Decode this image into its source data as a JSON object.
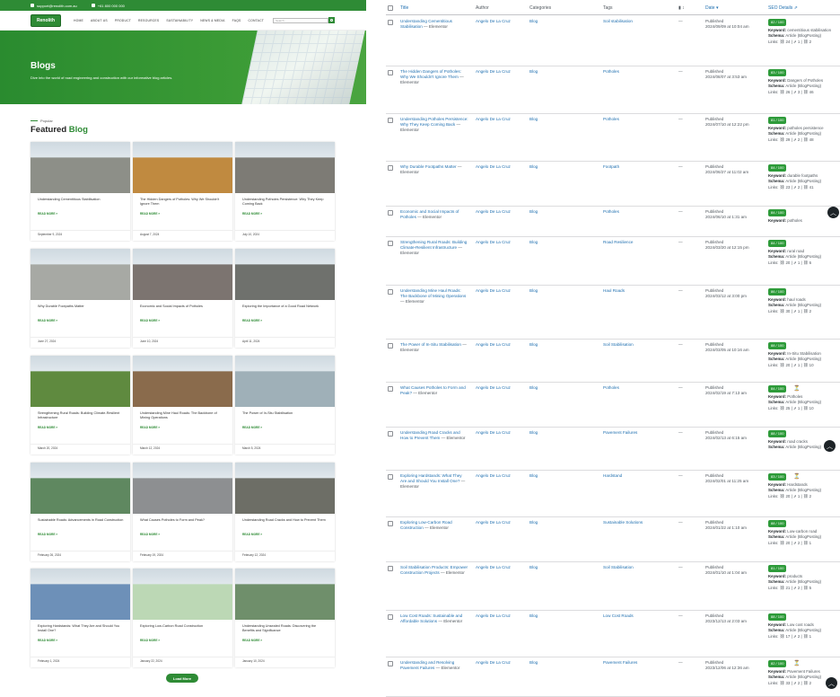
{
  "site": {
    "topbar": {
      "email": "support@renolith.com.au",
      "phone": "+61 800 000 000"
    },
    "logo": "Renolith",
    "menu": [
      "HOME",
      "ABOUT US",
      "PRODUCT",
      "RESOURCES",
      "SUSTAINABILITY",
      "NEWS & MEDIA",
      "FAQS",
      "CONTACT"
    ],
    "search_placeholder": "Search...",
    "hero": {
      "title": "Blogs",
      "subtitle": "Dive into the world of road engineering and construction with our informative blog articles."
    },
    "popular_label": "Popular",
    "featured": {
      "prefix": "Featured ",
      "accent": "Blog"
    },
    "read_more": "READ MORE »",
    "load_more": "Load More",
    "cards": [
      {
        "title": "Understanding Cementitious Stabilisation",
        "date": "September 9, 2024"
      },
      {
        "title": "The Hidden Dangers of Potholes: Why We Shouldn't Ignore Them",
        "date": "August 7, 2024"
      },
      {
        "title": "Understanding Potholes Persistence: Why They Keep Coming Back",
        "date": "July 10, 2024"
      },
      {
        "title": "Why Durable Footpaths Matter",
        "date": "June 27, 2024"
      },
      {
        "title": "Economic and Social Impacts of Potholes",
        "date": "June 10, 2024"
      },
      {
        "title": "Exploring the Importance of a Good Road Network",
        "date": "April 11, 2024"
      },
      {
        "title": "Strengthening Rural Roads: Building Climate-Resilient Infrastructure",
        "date": "March 20, 2024"
      },
      {
        "title": "Understanding Mine Haul Roads: The Backbone of Mining Operations",
        "date": "March 12, 2024"
      },
      {
        "title": "The Power of In-Situ Stabilisation",
        "date": "March 5, 2024"
      },
      {
        "title": "Sustainable Roads: Advancements in Road Construction",
        "date": "February 26, 2024"
      },
      {
        "title": "What Causes Potholes to Form and Peak?",
        "date": "February 19, 2024"
      },
      {
        "title": "Understanding Road Cracks and How to Prevent Them",
        "date": "February 12, 2024"
      },
      {
        "title": "Exploring Hardstands: What They Are and Should You Install One?",
        "date": "February 1, 2024"
      },
      {
        "title": "Exploring Low-Carbon Road Construction",
        "date": "January 22, 2024"
      },
      {
        "title": "Understanding Unsealed Roads: Discovering the Benefits and Significance",
        "date": "January 10, 2024"
      }
    ],
    "card_colors": [
      "#8d8f88",
      "#c08a40",
      "#7d7b75",
      "#a7a9a4",
      "#7c7470",
      "#6f716d",
      "#5f8a3f",
      "#8a6b4c",
      "#9fb0b8",
      "#5f8860",
      "#8d8f91",
      "#6d6e66",
      "#6d90b8",
      "#bcd8b5",
      "#6f8f6b"
    ]
  },
  "admin": {
    "headers": {
      "title": "Title",
      "author": "Author",
      "categories": "Categories",
      "tags": "Tags",
      "comments": "▮ ↕",
      "date": "Date ▾",
      "seo": "SEO Details ⇗"
    },
    "rows": [
      {
        "title": "Understanding Cementitious Stabilisation",
        "suffix": " — Elementor",
        "author": "Angelo De La Cruz",
        "category": "Blog",
        "tag": "Soil stabilisation",
        "comments": "—",
        "status": "Published",
        "date": "2024/09/09 at 10:04 am",
        "score": "82 / 100",
        "keyword": "cementitious stabilisation",
        "schema": "Article (BlogPosting)",
        "links": "Links: ⛓ 24 | ⇗ 1 | ⛓ 2"
      },
      {
        "title": "The Hidden Dangers of Potholes: Why We Shouldn't Ignore Them",
        "suffix": " — Elementor",
        "author": "Angelo De La Cruz",
        "category": "Blog",
        "tag": "Potholes",
        "comments": "—",
        "status": "Published",
        "date": "2024/08/07 at 3:53 am",
        "score": "83 / 100",
        "keyword": "Dangers of Potholes",
        "schema": "Article (BlogPosting)",
        "links": "Links: ⛓ 26 | ⇗ 3 | ⛓ 46"
      },
      {
        "title": "Understanding Potholes Persistence: Why They Keep Coming Back",
        "suffix": " — Elementor",
        "author": "Angelo De La Cruz",
        "category": "Blog",
        "tag": "Potholes",
        "comments": "—",
        "status": "Published",
        "date": "2024/07/10 at 12:22 pm",
        "score": "81 / 100",
        "keyword": "potholes persistence",
        "schema": "Article (BlogPosting)",
        "links": "Links: ⛓ 29 | ⇗ 2 | ⛓ 48"
      },
      {
        "title": "Why Durable Footpaths Matter",
        "suffix": " — Elementor",
        "author": "Angelo De La Cruz",
        "category": "Blog",
        "tag": "Footpath",
        "comments": "—",
        "status": "Published",
        "date": "2024/06/27 at 11:02 am",
        "score": "84 / 100",
        "keyword": "durable footpaths",
        "schema": "Article (BlogPosting)",
        "links": "Links: ⛓ 23 | ⇗ 2 | ⛓ 41"
      },
      {
        "title": "Economic and Social Impacts of Potholes",
        "suffix": " — Elementor",
        "author": "Angelo De La Cruz",
        "category": "Blog",
        "tag": "Potholes",
        "comments": "—",
        "status": "Published",
        "date": "2024/06/10 at 1:31 am",
        "score": "84 / 100",
        "keyword": "potholes",
        "schema": "",
        "links": ""
      },
      {
        "title": "Strengthening Rural Roads: Building Climate-Resilient Infrastructure",
        "suffix": " — Elementor",
        "author": "Angelo De La Cruz",
        "category": "Blog",
        "tag": "Road Resilience",
        "comments": "—",
        "status": "Published",
        "date": "2024/03/20 at 12:15 pm",
        "score": "84 / 100",
        "keyword": "rural road",
        "schema": "Article (BlogPosting)",
        "links": "Links: ⛓ 20 | ⇗ 1 | ⛓ 6"
      },
      {
        "title": "Understanding Mine Haul Roads: The Backbone of Mining Operations",
        "suffix": " — Elementor",
        "author": "Angelo De La Cruz",
        "category": "Blog",
        "tag": "Haul Roads",
        "comments": "—",
        "status": "Published",
        "date": "2024/03/12 at 3:00 pm",
        "score": "86 / 100",
        "keyword": "haul roads",
        "schema": "Article (BlogPosting)",
        "links": "Links: ⛓ 30 | ⇗ 1 | ⛓ 2"
      },
      {
        "title": "The Power of In-Situ Stabilisation",
        "suffix": " — Elementor",
        "author": "Angelo De La Cruz",
        "category": "Blog",
        "tag": "Soil Stabilisation",
        "comments": "—",
        "status": "Published",
        "date": "2024/03/05 at 10:16 am",
        "score": "88 / 100",
        "keyword": "In-Situ Stabilisation",
        "schema": "Article (BlogPosting)",
        "links": "Links: ⛓ 20 | ⇗ 1 | ⛓ 10"
      },
      {
        "title": "What Causes Potholes to Form and Peak?",
        "suffix": " — Elementor",
        "author": "Angelo De La Cruz",
        "category": "Blog",
        "tag": "Potholes",
        "comments": "—",
        "status": "Published",
        "date": "2024/02/19 at 7:13 am",
        "score": "84 / 100",
        "keyword": "Potholes",
        "schema": "Article (BlogPosting)",
        "links": "Links: ⛓ 25 | ⇗ 1 | ⛓ 10"
      },
      {
        "title": "Understanding Road Cracks and How to Prevent Them",
        "suffix": " — Elementor",
        "author": "Angelo De La Cruz",
        "category": "Blog",
        "tag": "Pavement Failures",
        "comments": "—",
        "status": "Published",
        "date": "2024/02/13 at 6:15 am",
        "score": "88 / 100",
        "keyword": "road cracks",
        "schema": "Article (BlogPosting)",
        "links": ""
      },
      {
        "title": "Exploring Hardstands: What They Are and Should You Install One?",
        "suffix": " — Elementor",
        "author": "Angelo De La Cruz",
        "category": "Blog",
        "tag": "Hardstand",
        "comments": "—",
        "status": "Published",
        "date": "2024/02/01 at 11:25 am",
        "score": "83 / 100",
        "keyword": "Hardstands",
        "schema": "Article (BlogPosting)",
        "links": "Links: ⛓ 20 | ⇗ 1 | ⛓ 2"
      },
      {
        "title": "Exploring Low-Carbon Road Construction",
        "suffix": " — Elementor",
        "author": "Angelo De La Cruz",
        "category": "Blog",
        "tag": "Sustainable Solutions",
        "comments": "—",
        "status": "Published",
        "date": "2024/01/22 at 1:10 am",
        "score": "88 / 100",
        "keyword": "Low-carbon road",
        "schema": "Article (BlogPosting)",
        "links": "Links: ⛓ 20 | ⇗ 2 | ⛓ 1"
      },
      {
        "title": "Soil Stabilisation Products: Empower Construction Projects",
        "suffix": " — Elementor",
        "author": "Angelo De La Cruz",
        "category": "Blog",
        "tag": "Soil Stabilisation",
        "comments": "—",
        "status": "Published",
        "date": "2024/01/10 at 1:04 am",
        "score": "81 / 100",
        "keyword": "products",
        "schema": "Article (BlogPosting)",
        "links": "Links: ⛓ 21 | ⇗ 2 | ⛓ 5"
      },
      {
        "title": "Low Cost Roads: Sustainable and Affordable Solutions",
        "suffix": " — Elementor",
        "author": "Angelo De La Cruz",
        "category": "Blog",
        "tag": "Low Cost Roads",
        "comments": "—",
        "status": "Published",
        "date": "2023/12/13 at 2:03 am",
        "score": "88 / 100",
        "keyword": "Low cost roads",
        "schema": "Article (BlogPosting)",
        "links": "Links: ⛓ 17 | ⇗ 2 | ⛓ 1"
      },
      {
        "title": "Understanding and Resolving Pavement Failures",
        "suffix": " — Elementor",
        "author": "Angelo De La Cruz",
        "category": "Blog",
        "tag": "Pavement Failures",
        "comments": "—",
        "status": "Published",
        "date": "2023/12/06 at 12:36 am",
        "score": "82 / 100",
        "keyword": "Pavement Failures",
        "schema": "Article (BlogPosting)",
        "links": "Links: ⛓ 33 | ⇗ 2 | ⛓ 2"
      }
    ],
    "score_color": "#2e9b3a"
  }
}
